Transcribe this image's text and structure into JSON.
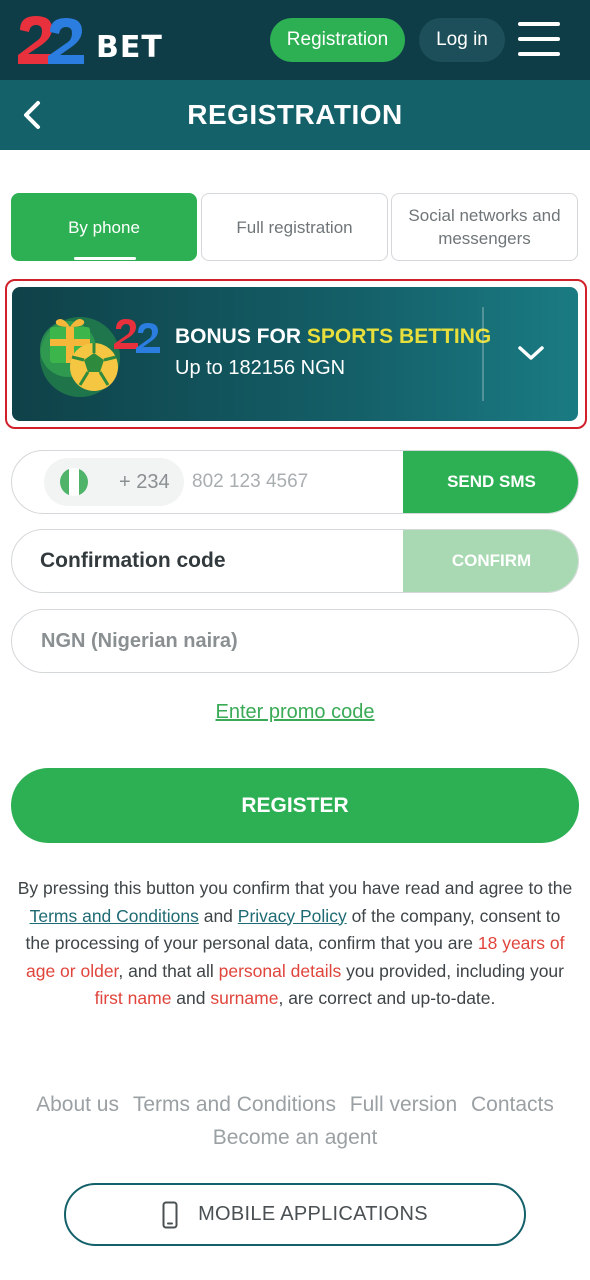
{
  "header": {
    "logo_text": "BET",
    "registration_label": "Registration",
    "login_label": "Log in"
  },
  "subheader": {
    "title": "REGISTRATION"
  },
  "tabs": [
    {
      "label": "By phone",
      "active": true
    },
    {
      "label": "Full registration",
      "active": false
    },
    {
      "label": "Social networks and messengers",
      "active": false
    }
  ],
  "bonus": {
    "title_prefix": "BONUS FOR ",
    "title_highlight": "SPORTS BETTING",
    "subtitle": "Up to 182156 NGN"
  },
  "phone": {
    "dial_code": "+ 234",
    "placeholder": "802 123 4567",
    "send_label": "SEND SMS"
  },
  "confirmation": {
    "placeholder": "Confirmation code",
    "confirm_label": "CONFIRM"
  },
  "currency": {
    "value": "NGN (Nigerian naira)"
  },
  "promo": {
    "label": "Enter promo code"
  },
  "register": {
    "label": "REGISTER"
  },
  "legal": {
    "t1": "By pressing this button you confirm that you have read and agree to the ",
    "terms": "Terms and Conditions",
    "t2": " and ",
    "privacy": "Privacy Policy",
    "t3": " of the company, consent to the processing of your personal data, confirm that you are ",
    "age": "18 years of age or older",
    "t4": ", and that all ",
    "details": "personal details",
    "t5": " you provided, including your ",
    "first_name": "first name",
    "t6": " and ",
    "surname": "surname",
    "t7": ", are correct and up-to-date."
  },
  "footer": {
    "links": [
      "About us",
      "Terms and Conditions",
      "Full version",
      "Contacts",
      "Become an agent"
    ],
    "mobile_apps": "MOBILE APPLICATIONS"
  },
  "colors": {
    "header_bg": "#0f3d47",
    "subheader_bg": "#14616a",
    "accent_green": "#2db053",
    "confirm_disabled": "#a8d9b2",
    "warning_red": "#e0443b",
    "highlight_yellow": "#e8df3c"
  },
  "icons": {
    "menu": "hamburger-icon",
    "back": "chevron-left-icon",
    "expand": "chevron-down-icon",
    "flag": "nigeria-flag-icon",
    "mobile": "smartphone-icon"
  }
}
